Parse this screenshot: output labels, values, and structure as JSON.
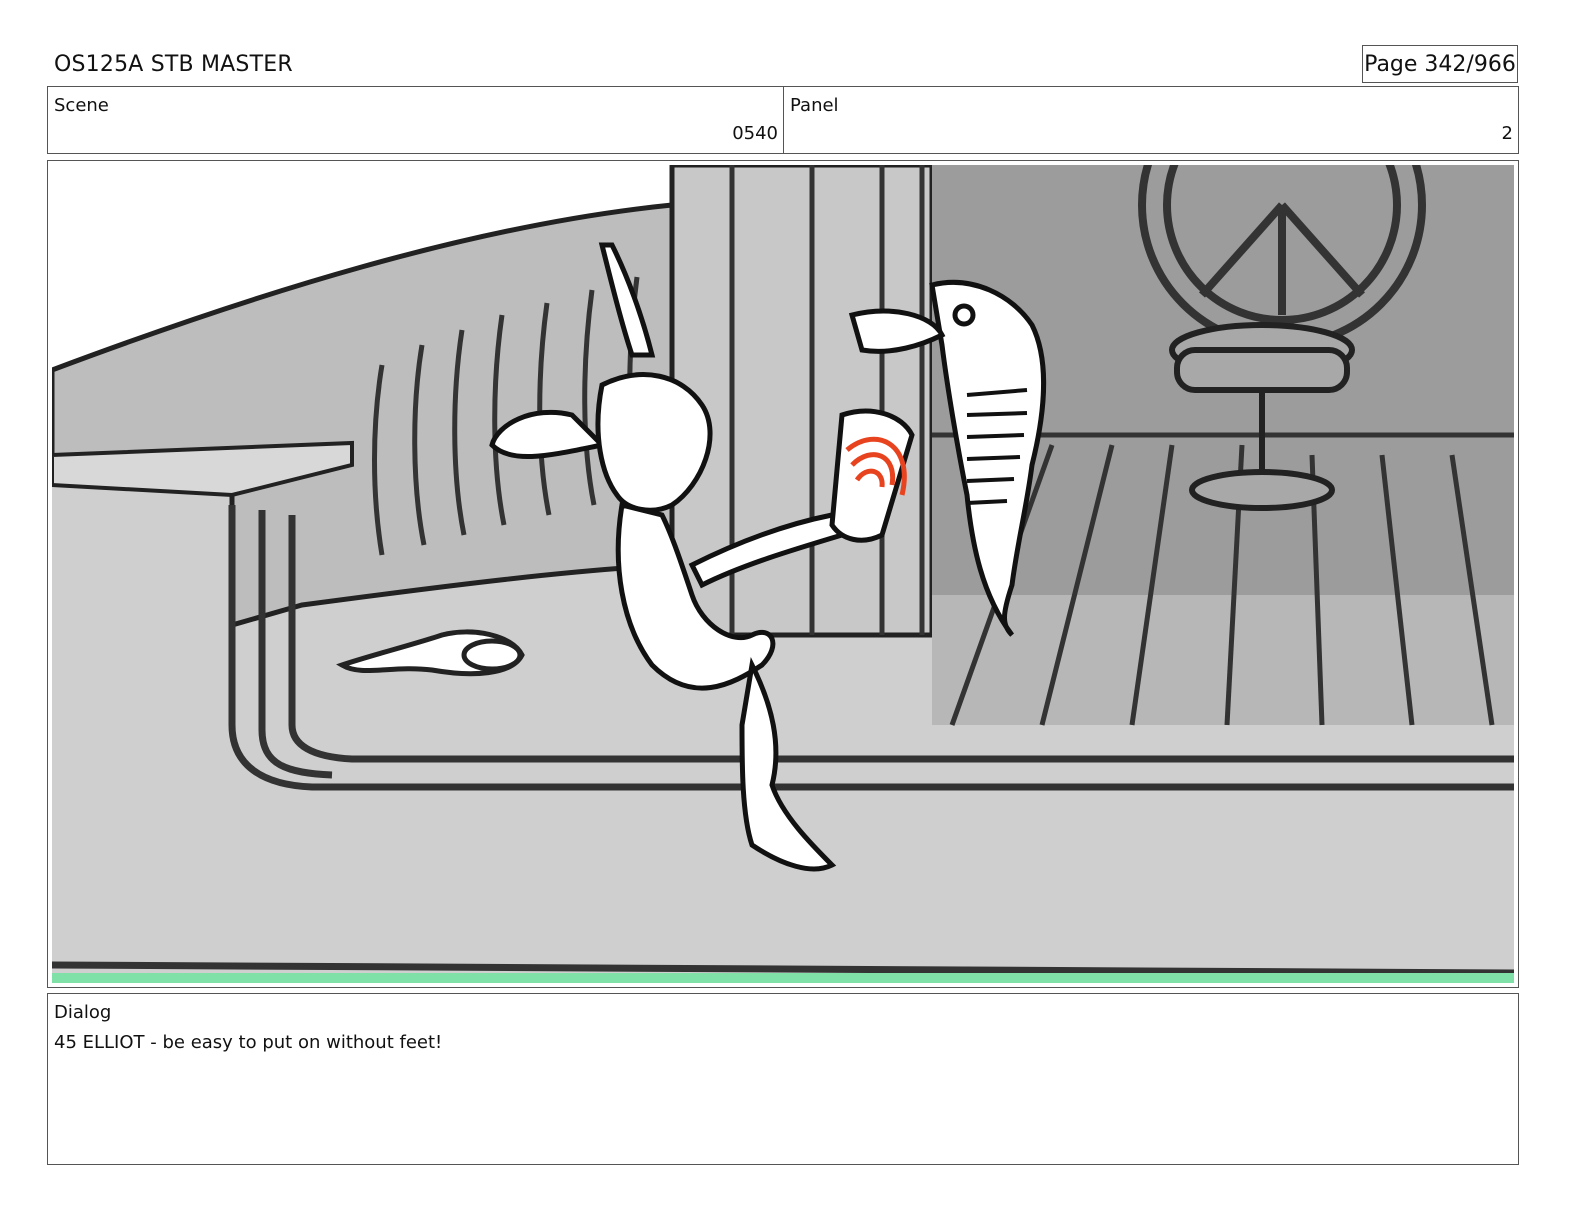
{
  "header": {
    "title": "OS125A STB MASTER",
    "page": "Page 342/966"
  },
  "info": {
    "scene_label": "Scene",
    "scene_value": "0540",
    "panel_label": "Panel",
    "panel_value": "2"
  },
  "dialog": {
    "label": "Dialog",
    "text": "45 ELLIOT - be easy to put on without feet!"
  },
  "colors": {
    "ink": "#222222",
    "background_gray": "#cfcfcf",
    "wall_gray": "#bdbdbd",
    "cabin_gray": "#9c9c9c",
    "accent_red": "#e8431f",
    "edge_green": "#7fe0a8"
  }
}
